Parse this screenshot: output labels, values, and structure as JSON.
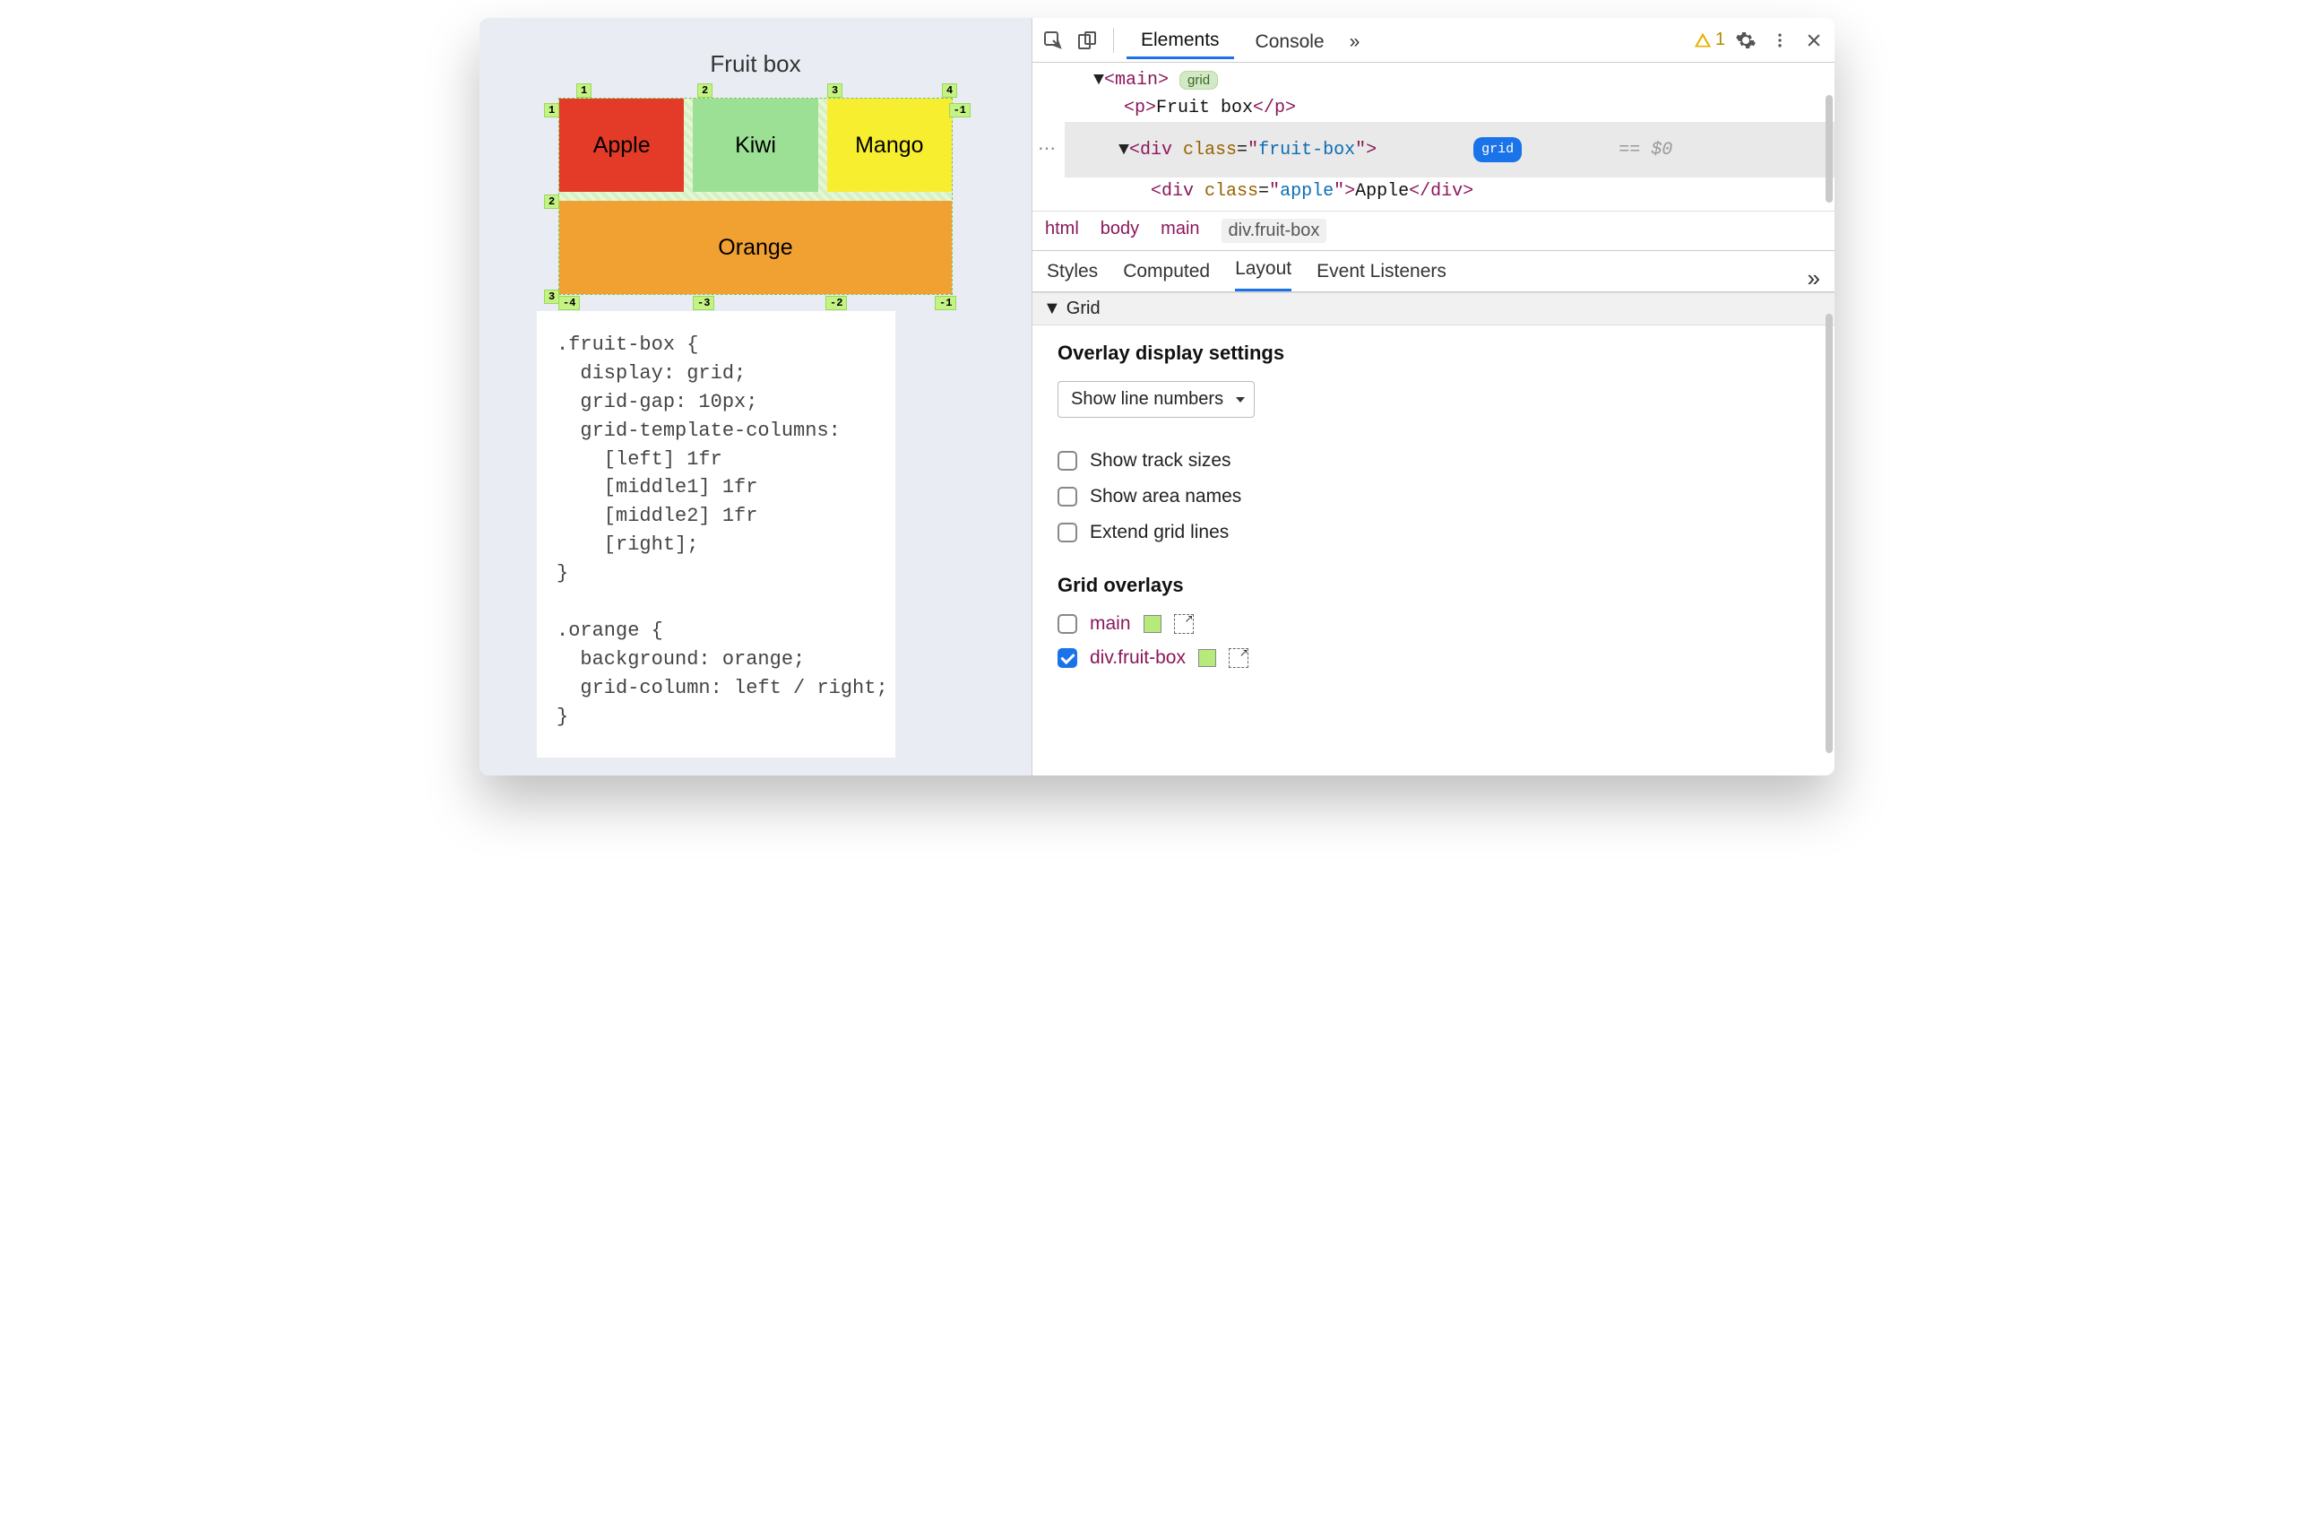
{
  "page": {
    "title": "Fruit box",
    "cells": {
      "apple": "Apple",
      "kiwi": "Kiwi",
      "mango": "Mango",
      "orange": "Orange"
    },
    "line_numbers": {
      "top": [
        "1",
        "2",
        "3",
        "4"
      ],
      "bottom": [
        "-4",
        "-3",
        "-2",
        "-1"
      ],
      "left": [
        "1",
        "2",
        "3"
      ],
      "right": [
        "-1"
      ]
    },
    "css_code": ".fruit-box {\n  display: grid;\n  grid-gap: 10px;\n  grid-template-columns:\n    [left] 1fr\n    [middle1] 1fr\n    [middle2] 1fr\n    [right];\n}\n\n.orange {\n  background: orange;\n  grid-column: left / right;\n}"
  },
  "devtools": {
    "tabs": {
      "elements": "Elements",
      "console": "Console",
      "more": "»"
    },
    "warning_count": "1",
    "dom": {
      "main_open": "<main>",
      "main_badge": "grid",
      "p_line": "<p>Fruit box</p>",
      "div_open": "<div class=\"fruit-box\">",
      "div_badge": "grid",
      "eq": "== $0",
      "child": "<div class=\"apple\">Apple</div>"
    },
    "breadcrumbs": [
      "html",
      "body",
      "main",
      "div.fruit-box"
    ],
    "side_tabs": [
      "Styles",
      "Computed",
      "Layout",
      "Event Listeners"
    ],
    "side_more": "»",
    "grid_section": "Grid",
    "overlay_settings": {
      "heading": "Overlay display settings",
      "select": "Show line numbers",
      "checkboxes": [
        "Show track sizes",
        "Show area names",
        "Extend grid lines"
      ]
    },
    "grid_overlays": {
      "heading": "Grid overlays",
      "items": [
        {
          "label": "main",
          "checked": false,
          "color": "#b6ea7a"
        },
        {
          "label": "div.fruit-box",
          "checked": true,
          "color": "#b6ea7a"
        }
      ]
    }
  }
}
